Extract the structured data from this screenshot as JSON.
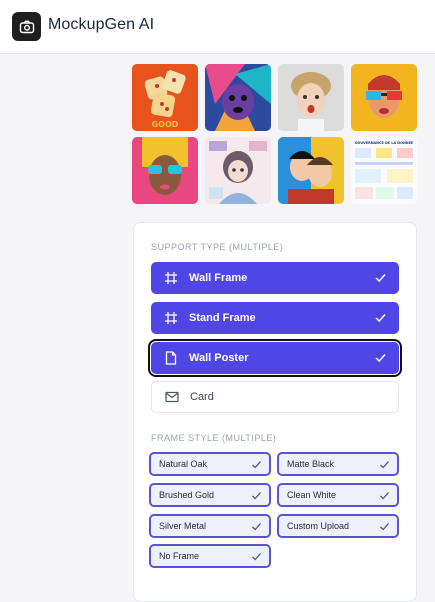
{
  "app": {
    "title": "MockupGen AI"
  },
  "icons": {
    "logo": "camera-icon",
    "wall_frame": "hash-icon",
    "stand_frame": "hash-icon",
    "wall_poster": "document-icon",
    "card": "envelope-icon",
    "check": "check-icon"
  },
  "colors": {
    "accent": "#4f46e5",
    "frame_border": "#5b53d6",
    "logo_bg": "#1f1f1f"
  },
  "gallery": [
    {
      "label": "GOOD",
      "alt": "Dice artwork"
    },
    {
      "label": "",
      "alt": "Colorful dog artwork"
    },
    {
      "label": "",
      "alt": "Surprised woman portrait"
    },
    {
      "label": "",
      "alt": "3D glasses portrait"
    },
    {
      "label": "",
      "alt": "Woman with sunglasses artwork"
    },
    {
      "label": "",
      "alt": "Anime girl poster"
    },
    {
      "label": "",
      "alt": "Pop art couple"
    },
    {
      "label": "GOUVERNANCE DE LA DONNEE",
      "alt": "Infographic"
    }
  ],
  "support": {
    "title": "SUPPORT TYPE (MULTIPLE)",
    "options": [
      {
        "label": "Wall Frame",
        "selected": true
      },
      {
        "label": "Stand Frame",
        "selected": true
      },
      {
        "label": "Wall Poster",
        "selected": true
      },
      {
        "label": "Card",
        "selected": false
      }
    ]
  },
  "frame": {
    "title": "FRAME STYLE (MULTIPLE)",
    "options": [
      {
        "label": "Natural Oak",
        "selected": true
      },
      {
        "label": "Matte Black",
        "selected": true
      },
      {
        "label": "Brushed Gold",
        "selected": true
      },
      {
        "label": "Clean White",
        "selected": true
      },
      {
        "label": "Silver Metal",
        "selected": true
      },
      {
        "label": "Custom Upload",
        "selected": true
      },
      {
        "label": "No Frame",
        "selected": true
      }
    ]
  }
}
